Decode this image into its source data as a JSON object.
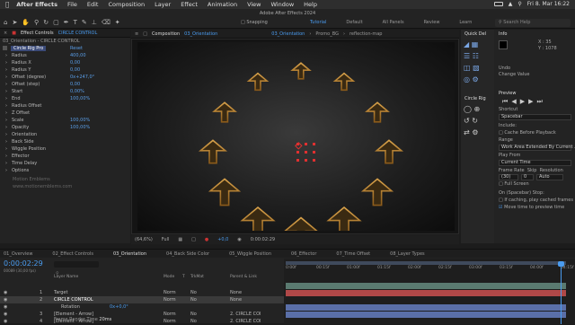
{
  "menubar": {
    "items": [
      "After Effects",
      "File",
      "Edit",
      "Composition",
      "Layer",
      "Effect",
      "Animation",
      "View",
      "Window",
      "Help"
    ],
    "datetime": "Fri 8. Mar  16:22"
  },
  "toolbar": {
    "title": "Adobe After Effects 2024",
    "snapping": "Snapping",
    "workspaces": [
      "Tutorial",
      "Default",
      "All Panels",
      "Review",
      "Learn"
    ],
    "search_placeholder": "Search Help"
  },
  "effect_controls": {
    "tab": "Effect Controls",
    "layer": "CIRCLE CONTROL",
    "subtitle": "03_Orientation - CIRCLE CONTROL",
    "effect_name": "Circle Rig Pro",
    "reset": "Reset",
    "rows": [
      {
        "name": "Radius",
        "value": "400,00"
      },
      {
        "name": "Radius X",
        "value": "0,00"
      },
      {
        "name": "Radius Y",
        "value": "0,00"
      },
      {
        "name": "Offset (degree)",
        "value": "0x+247,0°"
      },
      {
        "name": "Offset (step)",
        "value": "0,00"
      },
      {
        "name": "Start",
        "value": "0,00%"
      },
      {
        "name": "End",
        "value": "100,00%"
      },
      {
        "name": "Radius Offset",
        "value": ""
      },
      {
        "name": "Z Offset",
        "value": ""
      },
      {
        "name": "Scale",
        "value": "100,00%"
      },
      {
        "name": "Opacity",
        "value": "100,00%"
      },
      {
        "name": "Orientation",
        "value": ""
      },
      {
        "name": "Back Side",
        "value": ""
      },
      {
        "name": "Wiggle Position",
        "value": ""
      },
      {
        "name": "Effector",
        "value": ""
      },
      {
        "name": "Time Delay",
        "value": ""
      },
      {
        "name": "Options",
        "value": ""
      }
    ],
    "credit": "Motion Emblems",
    "url": "www.motionemblems.com"
  },
  "composition": {
    "tab": "Composition",
    "tab_name": "03_Orientation",
    "breadcrumbs": [
      "03_Orientation",
      "Promo_BG",
      "reflection-map"
    ],
    "zoom": "(64,6%)",
    "quality": "Full",
    "exposure": "+0,0",
    "timecode": "0:00:02:29"
  },
  "tools_panel": {
    "title": "Quick Del",
    "rig_title": "Circle Rig"
  },
  "info": {
    "title": "Info",
    "x_label": "X : 35",
    "y_label": "Y : 1078",
    "undo": "Undo",
    "change_value": "Change Value"
  },
  "preview": {
    "title": "Preview",
    "shortcut_label": "Shortcut",
    "shortcut": "Spacebar",
    "include": "Include:",
    "cache": "Cache Before Playback",
    "range_label": "Range",
    "range": "Work Area Extended By Current ...",
    "play_from_label": "Play From",
    "play_from": "Current Time",
    "frame_rate_label": "Frame Rate",
    "skip_label": "Skip",
    "resolution_label": "Resolution",
    "frame_rate": "(30)",
    "skip": "0",
    "resolution": "Auto",
    "full_screen": "Full Screen",
    "stop_label": "On (Spacebar) Stop:",
    "if_caching": "If caching, play cached frames",
    "move_time": "Move time to preview time"
  },
  "timeline": {
    "tabs": [
      "01_Overview",
      "02_Effect Controls",
      "03_Orientation",
      "04_Back Side Color",
      "05_Wiggle Position",
      "06_Effector",
      "07_Time Offset",
      "08_Layer Types"
    ],
    "timecode": "0:00:02:29",
    "frames": "00089 (30,00 fps)",
    "columns": [
      "Layer Name",
      "Mode",
      "T",
      "TrkMat",
      "Parent & Link"
    ],
    "layers": [
      {
        "num": "1",
        "name": "Target",
        "mode": "Norm",
        "trk": "No",
        "parent": "None"
      },
      {
        "num": "2",
        "name": "CIRCLE CONTROL",
        "mode": "Norm",
        "trk": "No",
        "parent": "None"
      },
      {
        "num": "",
        "name": "Rotation",
        "mode": "0x+0,0°",
        "trk": "",
        "parent": ""
      },
      {
        "num": "3",
        "name": "[Element - Arrow]",
        "mode": "Norm",
        "trk": "No",
        "parent": "2. CIRCLE COI"
      },
      {
        "num": "4",
        "name": "[Element - Arrow]",
        "mode": "Norm",
        "trk": "No",
        "parent": "2. CIRCLE COI"
      }
    ],
    "ruler": [
      "0:00f",
      "00:15f",
      "01:00f",
      "01:15f",
      "02:00f",
      "02:15f",
      "03:00f",
      "03:15f",
      "04:00f",
      "04:15f"
    ],
    "frame_render": "Frame Render Time",
    "render_time": "20ms",
    "colors": {
      "target": "#5a7a70",
      "control": "#b04848",
      "arrow": "#5a6fa8"
    }
  }
}
